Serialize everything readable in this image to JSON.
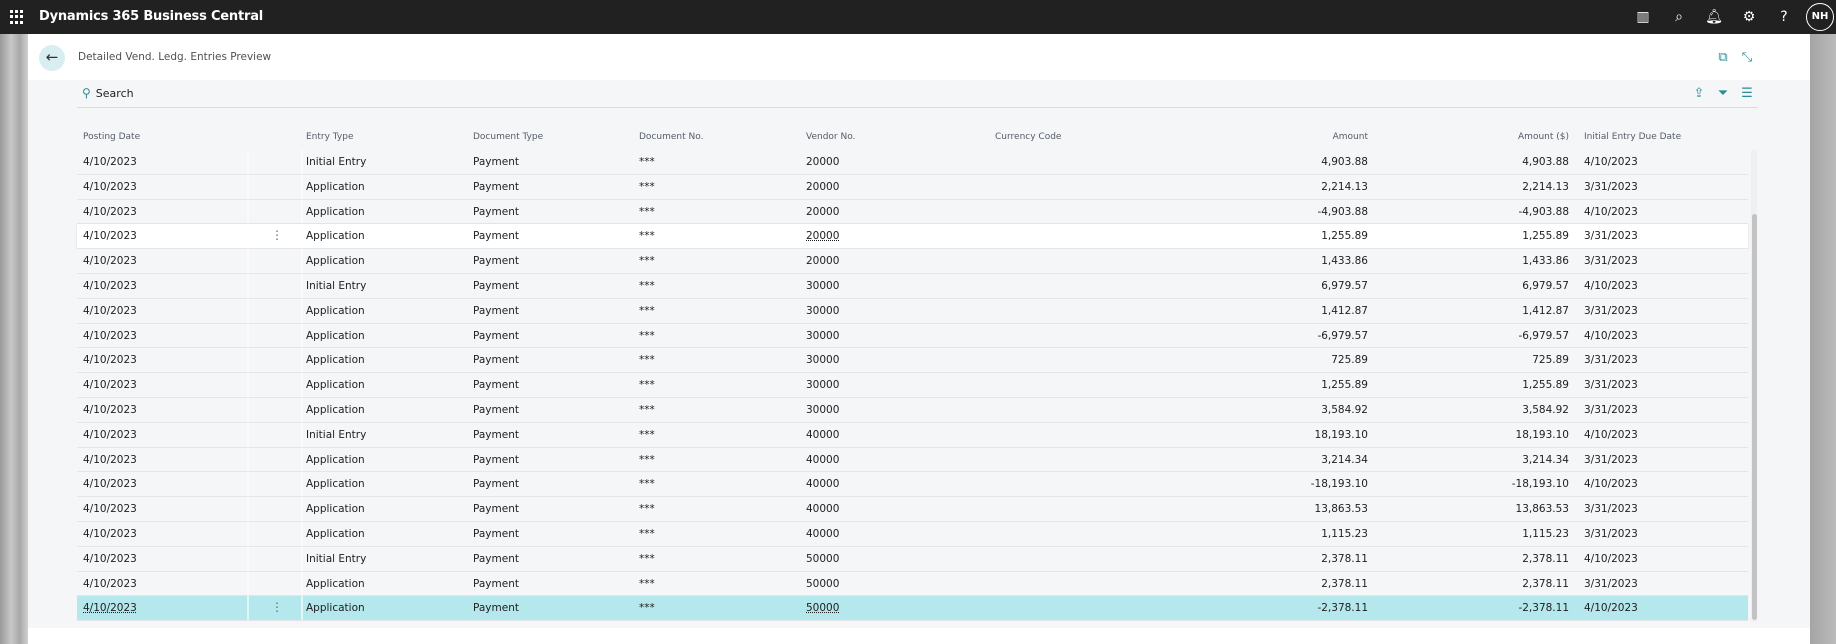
{
  "app": {
    "title": "Dynamics 365 Business Central",
    "user_initials": "NH"
  },
  "page": {
    "title": "Detailed Vend. Ledg. Entries Preview",
    "search_label": "Search"
  },
  "columns": [
    "Posting Date",
    "Entry Type",
    "Document Type",
    "Document No.",
    "Vendor No.",
    "Currency Code",
    "Amount",
    "Amount ($)",
    "Initial Entry Due Date"
  ],
  "rows": [
    [
      "4/10/2023",
      "Initial Entry",
      "Payment",
      "***",
      "20000",
      "",
      "4,903.88",
      "4,903.88",
      "4/10/2023"
    ],
    [
      "4/10/2023",
      "Application",
      "Payment",
      "***",
      "20000",
      "",
      "2,214.13",
      "2,214.13",
      "3/31/2023"
    ],
    [
      "4/10/2023",
      "Application",
      "Payment",
      "***",
      "20000",
      "",
      "-4,903.88",
      "-4,903.88",
      "4/10/2023"
    ],
    [
      "4/10/2023",
      "Application",
      "Payment",
      "***",
      "20000",
      "",
      "1,255.89",
      "1,255.89",
      "3/31/2023"
    ],
    [
      "4/10/2023",
      "Application",
      "Payment",
      "***",
      "20000",
      "",
      "1,433.86",
      "1,433.86",
      "3/31/2023"
    ],
    [
      "4/10/2023",
      "Initial Entry",
      "Payment",
      "***",
      "30000",
      "",
      "6,979.57",
      "6,979.57",
      "4/10/2023"
    ],
    [
      "4/10/2023",
      "Application",
      "Payment",
      "***",
      "30000",
      "",
      "1,412.87",
      "1,412.87",
      "3/31/2023"
    ],
    [
      "4/10/2023",
      "Application",
      "Payment",
      "***",
      "30000",
      "",
      "-6,979.57",
      "-6,979.57",
      "4/10/2023"
    ],
    [
      "4/10/2023",
      "Application",
      "Payment",
      "***",
      "30000",
      "",
      "725.89",
      "725.89",
      "3/31/2023"
    ],
    [
      "4/10/2023",
      "Application",
      "Payment",
      "***",
      "30000",
      "",
      "1,255.89",
      "1,255.89",
      "3/31/2023"
    ],
    [
      "4/10/2023",
      "Application",
      "Payment",
      "***",
      "30000",
      "",
      "3,584.92",
      "3,584.92",
      "3/31/2023"
    ],
    [
      "4/10/2023",
      "Initial Entry",
      "Payment",
      "***",
      "40000",
      "",
      "18,193.10",
      "18,193.10",
      "4/10/2023"
    ],
    [
      "4/10/2023",
      "Application",
      "Payment",
      "***",
      "40000",
      "",
      "3,214.34",
      "3,214.34",
      "3/31/2023"
    ],
    [
      "4/10/2023",
      "Application",
      "Payment",
      "***",
      "40000",
      "",
      "-18,193.10",
      "-18,193.10",
      "4/10/2023"
    ],
    [
      "4/10/2023",
      "Application",
      "Payment",
      "***",
      "40000",
      "",
      "13,863.53",
      "13,863.53",
      "3/31/2023"
    ],
    [
      "4/10/2023",
      "Application",
      "Payment",
      "***",
      "40000",
      "",
      "1,115.23",
      "1,115.23",
      "3/31/2023"
    ],
    [
      "4/10/2023",
      "Initial Entry",
      "Payment",
      "***",
      "50000",
      "",
      "2,378.11",
      "2,378.11",
      "4/10/2023"
    ],
    [
      "4/10/2023",
      "Application",
      "Payment",
      "***",
      "50000",
      "",
      "2,378.11",
      "2,378.11",
      "3/31/2023"
    ],
    [
      "4/10/2023",
      "Application",
      "Payment",
      "***",
      "50000",
      "",
      "-2,378.11",
      "-2,378.11",
      "4/10/2023"
    ]
  ],
  "hover_row": 3,
  "selected_row": 18,
  "colors": {
    "accent": "#2a8c96",
    "selected": "#b4e8ec",
    "topbar": "#212121"
  }
}
